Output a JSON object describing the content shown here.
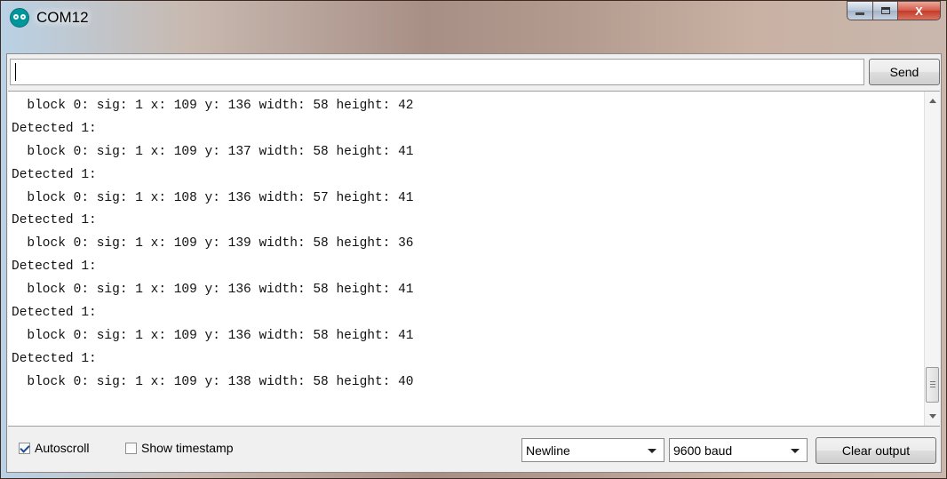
{
  "window": {
    "title": "COM12",
    "icon": "arduino-icon",
    "caption_buttons": {
      "minimize": "minimize-icon",
      "maximize": "maximize-icon",
      "close": "X"
    }
  },
  "send_bar": {
    "input_value": "",
    "send_label": "Send"
  },
  "output": {
    "lines": [
      "  block 0: sig: 1 x: 109 y: 136 width: 58 height: 42",
      "Detected 1:",
      "  block 0: sig: 1 x: 109 y: 137 width: 58 height: 41",
      "Detected 1:",
      "  block 0: sig: 1 x: 108 y: 136 width: 57 height: 41",
      "Detected 1:",
      "  block 0: sig: 1 x: 109 y: 139 width: 58 height: 36",
      "Detected 1:",
      "  block 0: sig: 1 x: 109 y: 136 width: 58 height: 41",
      "Detected 1:",
      "  block 0: sig: 1 x: 109 y: 136 width: 58 height: 41",
      "Detected 1:",
      "  block 0: sig: 1 x: 109 y: 138 width: 58 height: 40"
    ]
  },
  "footer": {
    "autoscroll": {
      "label": "Autoscroll",
      "checked": true
    },
    "show_timestamp": {
      "label": "Show timestamp",
      "checked": false
    },
    "line_ending": {
      "selected": "Newline"
    },
    "baud_rate": {
      "selected": "9600 baud"
    },
    "clear_label": "Clear output"
  }
}
